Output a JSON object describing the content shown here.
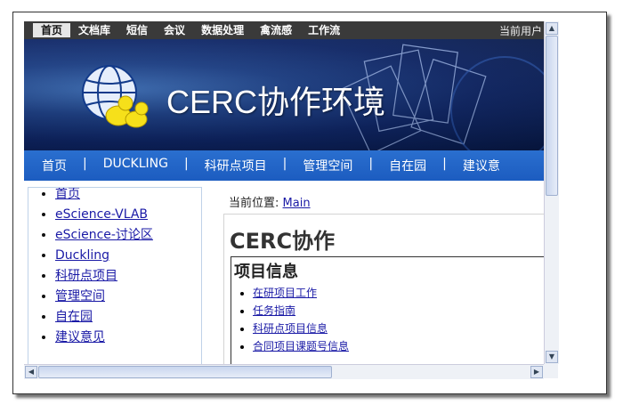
{
  "topnav": {
    "items": [
      "首页",
      "文档库",
      "短信",
      "会议",
      "数据处理",
      "禽流感",
      "工作流"
    ],
    "user_label": "当前用户"
  },
  "banner": {
    "title": "CERC协作环境"
  },
  "mainnav": {
    "items": [
      "首页",
      "DUCKLING",
      "科研点项目",
      "管理空间",
      "自在园",
      "建议意"
    ],
    "separator": "|"
  },
  "sidebar": {
    "items": [
      "首页",
      "eScience-VLAB",
      "eScience-讨论区",
      "Duckling",
      "科研点项目",
      "管理空间",
      "自在园",
      "建议意见"
    ]
  },
  "content": {
    "breadcrumb_label": "当前位置:",
    "breadcrumb_link": "Main",
    "heading": "CERC协作",
    "section_title": "项目信息",
    "links": [
      "在研项目工作",
      "任务指南",
      "科研点项目信息",
      "合同项目课题号信息"
    ]
  },
  "colors": {
    "topnav_bg": "#3a3a3a",
    "mainnav_bg": "#1c5cc0",
    "link": "#1a1aa6"
  }
}
